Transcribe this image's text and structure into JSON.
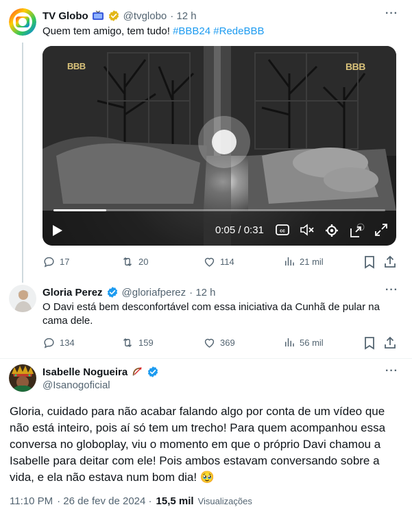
{
  "tweet1": {
    "name": "TV Globo",
    "handle": "@tvglobo",
    "time": "· 12 h",
    "text": "Quem tem amigo, tem tudo! ",
    "hashtags": "#BBB24 #RedeBBB",
    "video": {
      "watermark_small": "BBB",
      "watermark_right": "BBB",
      "time_display": "0:05 / 0:31",
      "progress": 0.16
    },
    "stats": {
      "replies": "17",
      "reposts": "20",
      "likes": "114",
      "views": "21 mil"
    }
  },
  "tweet2": {
    "name": "Gloria Perez",
    "handle": "@gloriafperez",
    "time": "· 12 h",
    "text": "O Davi está bem desconfortável com essa iniciativa da Cunhã de pular na cama dele.",
    "stats": {
      "replies": "134",
      "reposts": "159",
      "likes": "369",
      "views": "56 mil"
    }
  },
  "tweet3": {
    "name": "Isabelle Nogueira",
    "handle": "@Isanogoficial",
    "text": "Gloria, cuidado para não acabar falando algo por conta de um vídeo que não está inteiro, pois aí só tem um trecho! Para quem acompanhou essa conversa no globoplay, viu o momento em que o próprio Davi chamou a Isabelle para deitar com ele! Pois ambos estavam conversando sobre a vida, e ela não estava num bom dia! 🥹",
    "footer": {
      "time": "11:10 PM",
      "date": "· 26 de fev de 2024 ·",
      "views_count": "15,5 mil",
      "views_label": "Visualizações"
    }
  },
  "colors": {
    "accent": "#1d9bf0",
    "gold": "#e2b719",
    "muted": "#536471"
  }
}
